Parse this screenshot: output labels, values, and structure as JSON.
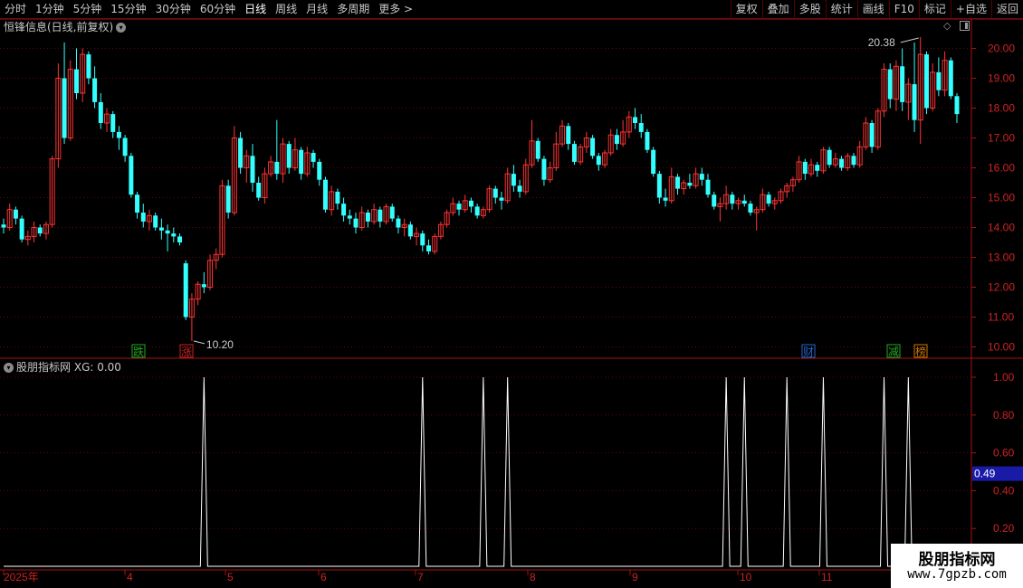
{
  "toolbar": {
    "periods": [
      "分时",
      "1分钟",
      "5分钟",
      "15分钟",
      "30分钟",
      "60分钟",
      "日线",
      "周线",
      "月线",
      "多周期",
      "更多 >"
    ],
    "active_period": "日线",
    "buttons": [
      "复权",
      "叠加",
      "多股",
      "统计",
      "画线",
      "F10",
      "标记",
      "+自选",
      "返回"
    ]
  },
  "main_chart": {
    "title": "恒锋信息(日线,前复权)",
    "price_axis": [
      "20.00",
      "19.00",
      "18.00",
      "17.00",
      "16.00",
      "15.00",
      "14.00",
      "13.00",
      "12.00",
      "11.00",
      "10.00"
    ],
    "high_label": "20.38",
    "low_label": "10.20",
    "markers": [
      {
        "text": "跌",
        "color": "#22aa22"
      },
      {
        "text": "涨",
        "color": "#cc2222"
      },
      {
        "text": "财",
        "color": "#2266cc"
      },
      {
        "text": "减",
        "color": "#22aa22"
      },
      {
        "text": "榜",
        "color": "#cc7700"
      }
    ]
  },
  "indicator": {
    "title": "股朋指标网",
    "value_label": "XG: 0.00",
    "axis": [
      "1.00",
      "0.80",
      "0.60",
      "0.40",
      "0.20"
    ],
    "current_value": "0.49"
  },
  "time_axis": [
    "2025年",
    "4",
    "5",
    "6",
    "7",
    "8",
    "9",
    "10",
    "11"
  ],
  "watermark": {
    "line1": "股朋指标网",
    "line2": "www.7gpzb.com"
  },
  "chart_data": [
    {
      "type": "candlestick",
      "title": "恒锋信息(日线,前复权)",
      "ylim": [
        9.8,
        20.5
      ],
      "annotations": {
        "high": 20.38,
        "low": 10.2
      },
      "x_ticks": [
        "2025年",
        "4",
        "5",
        "6",
        "7",
        "8",
        "9",
        "10",
        "11"
      ],
      "candles": [
        [
          14.1,
          14.3,
          13.8,
          14.0
        ],
        [
          14.0,
          14.8,
          13.9,
          14.6
        ],
        [
          14.6,
          14.7,
          14.1,
          14.3
        ],
        [
          14.3,
          14.4,
          13.5,
          13.6
        ],
        [
          13.6,
          13.9,
          13.4,
          13.7
        ],
        [
          13.7,
          14.2,
          13.5,
          14.0
        ],
        [
          14.0,
          14.1,
          13.7,
          13.8
        ],
        [
          13.8,
          14.2,
          13.6,
          14.1
        ],
        [
          14.1,
          16.4,
          14.0,
          16.3
        ],
        [
          16.3,
          19.5,
          16.0,
          19.0
        ],
        [
          19.0,
          20.2,
          16.8,
          17.0
        ],
        [
          17.0,
          19.6,
          16.9,
          19.3
        ],
        [
          19.3,
          20.0,
          18.3,
          18.5
        ],
        [
          18.5,
          20.0,
          18.2,
          19.8
        ],
        [
          19.8,
          19.9,
          18.8,
          19.0
        ],
        [
          19.0,
          19.4,
          18.0,
          18.2
        ],
        [
          18.2,
          18.5,
          17.3,
          17.5
        ],
        [
          17.5,
          18.0,
          17.2,
          17.8
        ],
        [
          17.8,
          17.9,
          17.0,
          17.2
        ],
        [
          17.2,
          17.4,
          16.6,
          17.0
        ],
        [
          17.0,
          17.1,
          16.2,
          16.4
        ],
        [
          16.4,
          16.5,
          15.0,
          15.1
        ],
        [
          15.1,
          15.2,
          14.3,
          14.5
        ],
        [
          14.5,
          14.8,
          14.0,
          14.2
        ],
        [
          14.2,
          14.6,
          13.9,
          14.4
        ],
        [
          14.4,
          14.5,
          13.9,
          14.0
        ],
        [
          14.0,
          14.3,
          13.6,
          13.9
        ],
        [
          13.9,
          14.1,
          13.2,
          13.8
        ],
        [
          13.8,
          14.0,
          13.5,
          13.7
        ],
        [
          13.7,
          13.8,
          13.4,
          13.5
        ],
        [
          12.8,
          12.9,
          10.9,
          11.0
        ],
        [
          11.0,
          11.8,
          10.2,
          11.6
        ],
        [
          11.6,
          12.2,
          11.4,
          12.1
        ],
        [
          12.1,
          12.5,
          11.8,
          12.0
        ],
        [
          12.0,
          13.1,
          11.9,
          12.9
        ],
        [
          12.9,
          13.3,
          12.6,
          13.1
        ],
        [
          13.1,
          15.6,
          13.0,
          15.4
        ],
        [
          15.4,
          15.6,
          14.3,
          14.5
        ],
        [
          14.5,
          17.4,
          14.4,
          17.0
        ],
        [
          17.0,
          17.2,
          15.8,
          16.0
        ],
        [
          16.0,
          16.6,
          15.5,
          16.4
        ],
        [
          16.4,
          16.8,
          15.2,
          15.5
        ],
        [
          15.5,
          15.7,
          14.9,
          15.0
        ],
        [
          15.0,
          16.0,
          14.8,
          15.8
        ],
        [
          15.8,
          16.4,
          15.7,
          16.2
        ],
        [
          16.2,
          17.6,
          15.6,
          15.8
        ],
        [
          15.8,
          17.0,
          15.5,
          16.8
        ],
        [
          16.8,
          16.9,
          15.8,
          16.0
        ],
        [
          16.0,
          17.0,
          15.9,
          16.6
        ],
        [
          16.6,
          16.7,
          15.6,
          15.8
        ],
        [
          15.8,
          16.7,
          15.7,
          16.5
        ],
        [
          16.5,
          16.6,
          16.0,
          16.2
        ],
        [
          16.2,
          16.3,
          15.4,
          15.6
        ],
        [
          15.6,
          15.7,
          14.5,
          14.6
        ],
        [
          14.6,
          15.4,
          14.4,
          15.2
        ],
        [
          15.2,
          15.3,
          14.6,
          14.8
        ],
        [
          14.8,
          15.0,
          14.2,
          14.4
        ],
        [
          14.4,
          14.6,
          14.1,
          14.3
        ],
        [
          14.3,
          14.5,
          13.8,
          14.0
        ],
        [
          14.0,
          14.7,
          13.9,
          14.5
        ],
        [
          14.5,
          14.6,
          14.0,
          14.2
        ],
        [
          14.2,
          14.8,
          14.1,
          14.6
        ],
        [
          14.6,
          14.7,
          14.0,
          14.2
        ],
        [
          14.2,
          14.8,
          14.1,
          14.7
        ],
        [
          14.7,
          14.8,
          14.2,
          14.3
        ],
        [
          14.3,
          14.4,
          13.8,
          14.0
        ],
        [
          14.0,
          14.3,
          13.7,
          14.1
        ],
        [
          14.1,
          14.2,
          13.6,
          13.7
        ],
        [
          13.7,
          14.0,
          13.4,
          13.8
        ],
        [
          13.8,
          13.9,
          13.2,
          13.4
        ],
        [
          13.4,
          13.6,
          13.1,
          13.2
        ],
        [
          13.2,
          13.8,
          13.1,
          13.7
        ],
        [
          13.7,
          14.2,
          13.6,
          14.1
        ],
        [
          14.1,
          14.6,
          14.0,
          14.5
        ],
        [
          14.5,
          15.0,
          14.4,
          14.8
        ],
        [
          14.8,
          14.9,
          14.4,
          14.6
        ],
        [
          14.6,
          15.1,
          14.5,
          14.9
        ],
        [
          14.9,
          15.0,
          14.5,
          14.7
        ],
        [
          14.7,
          14.8,
          14.3,
          14.4
        ],
        [
          14.4,
          14.7,
          14.3,
          14.6
        ],
        [
          14.6,
          15.4,
          14.5,
          15.3
        ],
        [
          15.3,
          15.4,
          14.8,
          15.0
        ],
        [
          15.0,
          15.2,
          14.6,
          14.9
        ],
        [
          14.9,
          16.0,
          14.8,
          15.8
        ],
        [
          15.8,
          16.1,
          15.2,
          15.4
        ],
        [
          15.4,
          15.6,
          15.0,
          15.2
        ],
        [
          15.2,
          16.3,
          15.1,
          16.1
        ],
        [
          16.1,
          17.6,
          16.0,
          16.9
        ],
        [
          16.9,
          17.0,
          16.2,
          16.3
        ],
        [
          16.3,
          16.4,
          15.4,
          15.6
        ],
        [
          15.6,
          16.2,
          15.5,
          16.0
        ],
        [
          16.0,
          17.2,
          15.9,
          16.8
        ],
        [
          16.8,
          17.6,
          16.7,
          17.4
        ],
        [
          17.4,
          17.5,
          16.6,
          16.8
        ],
        [
          16.8,
          16.9,
          16.1,
          16.2
        ],
        [
          16.2,
          16.8,
          16.1,
          16.7
        ],
        [
          16.7,
          17.2,
          16.5,
          17.0
        ],
        [
          17.0,
          17.1,
          16.3,
          16.4
        ],
        [
          16.4,
          16.5,
          15.9,
          16.1
        ],
        [
          16.1,
          16.6,
          16.0,
          16.5
        ],
        [
          16.5,
          17.3,
          16.4,
          17.1
        ],
        [
          17.1,
          17.3,
          16.6,
          16.8
        ],
        [
          16.8,
          17.6,
          16.7,
          17.2
        ],
        [
          17.2,
          17.9,
          17.0,
          17.7
        ],
        [
          17.7,
          18.0,
          17.3,
          17.5
        ],
        [
          17.5,
          17.8,
          17.0,
          17.2
        ],
        [
          17.2,
          17.3,
          16.5,
          16.6
        ],
        [
          16.6,
          16.7,
          15.7,
          15.8
        ],
        [
          15.8,
          15.9,
          14.8,
          15.0
        ],
        [
          15.0,
          15.3,
          14.7,
          14.9
        ],
        [
          14.9,
          16.0,
          14.8,
          15.7
        ],
        [
          15.7,
          15.8,
          15.1,
          15.3
        ],
        [
          15.3,
          15.6,
          15.1,
          15.5
        ],
        [
          15.5,
          15.8,
          15.3,
          15.4
        ],
        [
          15.4,
          16.0,
          15.3,
          15.8
        ],
        [
          15.8,
          16.0,
          15.4,
          15.6
        ],
        [
          15.6,
          15.8,
          15.0,
          15.1
        ],
        [
          15.1,
          15.2,
          14.6,
          14.7
        ],
        [
          14.7,
          15.0,
          14.2,
          14.8
        ],
        [
          14.8,
          15.4,
          14.6,
          15.1
        ],
        [
          15.1,
          15.2,
          14.6,
          14.8
        ],
        [
          14.8,
          15.0,
          14.6,
          14.9
        ],
        [
          14.9,
          15.1,
          14.7,
          14.8
        ],
        [
          14.8,
          14.9,
          14.4,
          14.5
        ],
        [
          14.5,
          14.7,
          13.9,
          14.6
        ],
        [
          14.6,
          15.3,
          14.5,
          15.1
        ],
        [
          15.1,
          15.2,
          14.7,
          14.8
        ],
        [
          14.8,
          15.0,
          14.6,
          14.9
        ],
        [
          14.9,
          15.3,
          14.8,
          15.2
        ],
        [
          15.2,
          15.5,
          15.0,
          15.4
        ],
        [
          15.4,
          15.7,
          15.2,
          15.6
        ],
        [
          15.6,
          16.4,
          15.5,
          16.2
        ],
        [
          16.2,
          16.3,
          15.6,
          15.8
        ],
        [
          15.8,
          16.3,
          15.7,
          16.1
        ],
        [
          16.1,
          16.2,
          15.7,
          15.9
        ],
        [
          15.9,
          16.7,
          15.8,
          16.6
        ],
        [
          16.6,
          16.7,
          16.0,
          16.1
        ],
        [
          16.1,
          16.5,
          16.0,
          16.3
        ],
        [
          16.3,
          16.4,
          15.9,
          16.0
        ],
        [
          16.0,
          16.5,
          15.9,
          16.4
        ],
        [
          16.4,
          16.5,
          16.0,
          16.1
        ],
        [
          16.1,
          16.9,
          16.0,
          16.7
        ],
        [
          16.7,
          17.7,
          16.6,
          17.5
        ],
        [
          17.5,
          17.6,
          16.5,
          16.7
        ],
        [
          16.7,
          18.0,
          16.6,
          17.9
        ],
        [
          17.9,
          19.5,
          17.7,
          19.3
        ],
        [
          19.3,
          19.5,
          18.0,
          18.3
        ],
        [
          18.3,
          19.6,
          17.9,
          19.4
        ],
        [
          19.4,
          20.0,
          17.9,
          18.2
        ],
        [
          18.2,
          19.0,
          17.6,
          18.8
        ],
        [
          18.8,
          20.2,
          17.2,
          17.6
        ],
        [
          17.6,
          20.38,
          16.8,
          19.8
        ],
        [
          19.8,
          19.9,
          17.8,
          18.0
        ],
        [
          18.0,
          19.5,
          17.9,
          19.2
        ],
        [
          19.2,
          19.7,
          18.4,
          18.6
        ],
        [
          18.6,
          19.9,
          18.4,
          19.6
        ],
        [
          19.6,
          19.7,
          18.3,
          18.4
        ],
        [
          18.4,
          18.5,
          17.5,
          17.8
        ]
      ]
    },
    {
      "type": "line",
      "title": "股朋指标网",
      "series": [
        {
          "name": "XG",
          "signal_indices": [
            33,
            69,
            79,
            83,
            119,
            122,
            129,
            135,
            145,
            149
          ]
        }
      ],
      "ylim": [
        0,
        1.05
      ],
      "current_value": 0.49
    }
  ]
}
